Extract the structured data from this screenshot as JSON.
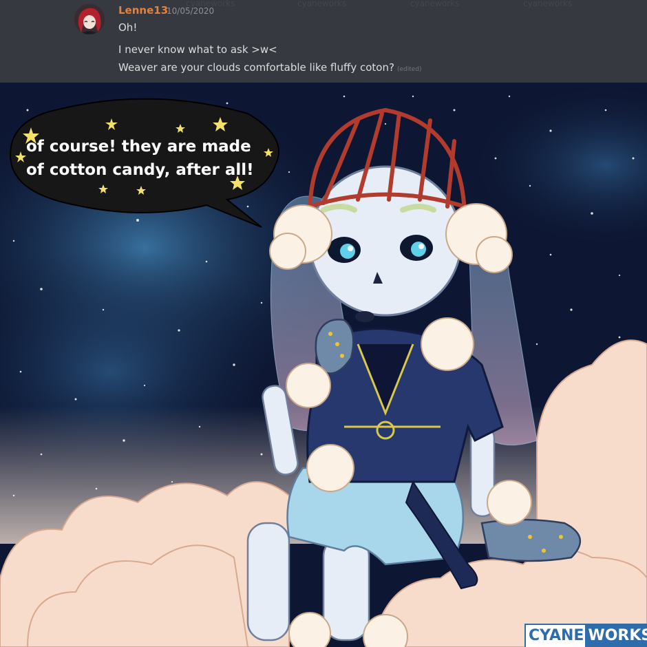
{
  "message": {
    "username": "Lenne13",
    "timestamp": "10/05/2020",
    "lines": [
      "Oh!",
      "I never know what to ask >w<",
      "Weaver are your clouds comfortable like fluffy coton?"
    ],
    "edited_label": "(edited)",
    "watermark": "cyaneworks"
  },
  "bubble": {
    "line1": "of course! they are made",
    "line2": "of cotton candy, after all!"
  },
  "logo": {
    "part1": "CYANE",
    "part2": "WORKS"
  },
  "colors": {
    "chat_bg": "#36393f",
    "username": "#e6803a",
    "sky": "#0d1733",
    "cloud": "#f8dccb",
    "hoodie": "#27386f",
    "logo_blue": "#2f6cab"
  }
}
